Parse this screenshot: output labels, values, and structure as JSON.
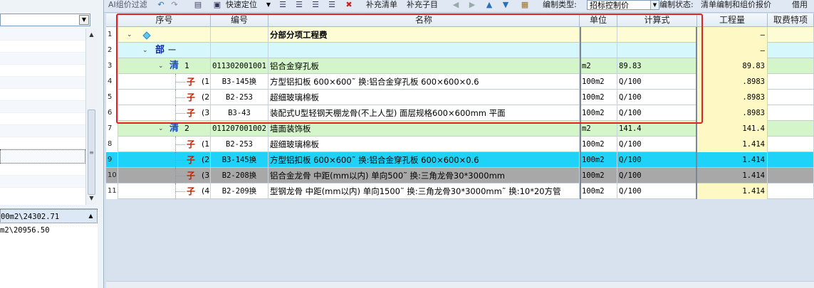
{
  "toolbar": {
    "ai_label": "AI组价过滤",
    "quick_locate": "快速定位",
    "add_list": "补充清单",
    "add_sub": "补充子目",
    "compile_type_label": "编制类型:",
    "compile_type_value": "招标控制价",
    "compile_status_label": "编制状态:",
    "compile_status_value": "清单编制和组价报价",
    "borrow_label": "借用"
  },
  "left_panel": {
    "items": [
      "00m2\\24302.71",
      "m2\\20956.50"
    ]
  },
  "grid": {
    "headers": {
      "xuhao": "序号",
      "bianhao": "编号",
      "mingcheng": "名称",
      "danwei": "单位",
      "jisuanshi": "计算式",
      "gongchengliang": "工程量",
      "qufei": "取费特项"
    },
    "rows": [
      {
        "n": "1",
        "level": "root",
        "seq": "",
        "code": "",
        "name": "分部分项工程费",
        "unit": "",
        "formula": "",
        "qty": "—",
        "style": "fenbu"
      },
      {
        "n": "2",
        "level": "bu",
        "seq": "一",
        "code": "",
        "name": "",
        "unit": "",
        "formula": "",
        "qty": "—",
        "style": "bu"
      },
      {
        "n": "3",
        "level": "qing",
        "seq": "1",
        "code": "011302001001",
        "name": "铝合金穿孔板",
        "unit": "m2",
        "formula": "89.83",
        "qty": "89.83",
        "style": "qing"
      },
      {
        "n": "4",
        "level": "zi",
        "seq": "(1",
        "code": "B3-145换",
        "name": "方型铝扣板 600×600˜ 换:铝合金穿孔板 600×600×0.6",
        "unit": "100m2",
        "formula": "Q/100",
        "qty": ".8983",
        "style": "white"
      },
      {
        "n": "5",
        "level": "zi",
        "seq": "(2",
        "code": "B2-253",
        "name": "超细玻璃棉板",
        "unit": "100m2",
        "formula": "Q/100",
        "qty": ".8983",
        "style": "white"
      },
      {
        "n": "6",
        "level": "zi",
        "seq": "(3",
        "code": "B3-43",
        "name": "装配式U型轻钢天棚龙骨(不上人型) 面层规格600×600mm 平面",
        "unit": "100m2",
        "formula": "Q/100",
        "qty": ".8983",
        "style": "white"
      },
      {
        "n": "7",
        "level": "qing",
        "seq": "2",
        "code": "011207001002",
        "name": "墙面装饰板",
        "unit": "m2",
        "formula": "141.4",
        "qty": "141.4",
        "style": "qing"
      },
      {
        "n": "8",
        "level": "zi",
        "seq": "(1",
        "code": "B2-253",
        "name": "超细玻璃棉板",
        "unit": "100m2",
        "formula": "Q/100",
        "qty": "1.414",
        "style": "white"
      },
      {
        "n": "9",
        "level": "zi",
        "seq": "(2",
        "code": "B3-145换",
        "name": "方型铝扣板 600×600˜ 换:铝合金穿孔板 600×600×0.6",
        "unit": "100m2",
        "formula": "Q/100",
        "qty": "1.414",
        "style": "cyan"
      },
      {
        "n": "10",
        "level": "zi",
        "seq": "(3",
        "code": "B2-208换",
        "name": "铝合金龙骨 中距(mm以内) 单向500˜ 换:三角龙骨30*3000mm",
        "unit": "100m2",
        "formula": "Q/100",
        "qty": "1.414",
        "style": "gray"
      },
      {
        "n": "11",
        "level": "zi",
        "seq": "(4",
        "code": "B2-209换",
        "name": "型钢龙骨 中距(mm以内) 单向1500˜ 换:三角龙骨30*3000mm˜ 换:10*20方管",
        "unit": "100m2",
        "formula": "Q/100",
        "qty": "1.414",
        "style": "white"
      }
    ],
    "marks": {
      "bu": "部",
      "qing": "清",
      "zi": "子"
    }
  }
}
